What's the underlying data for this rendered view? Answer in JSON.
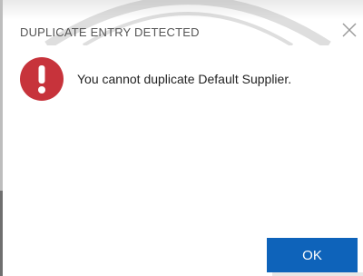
{
  "dialog": {
    "title": "DUPLICATE ENTRY DETECTED",
    "message": "You cannot duplicate Default Supplier.",
    "ok_label": "OK"
  },
  "icons": {
    "close": "close-icon",
    "alert": "exclamation-circle-icon"
  },
  "colors": {
    "alert_icon": "#c7333b",
    "ok_button": "#0e63ba",
    "title_text": "#555555"
  }
}
